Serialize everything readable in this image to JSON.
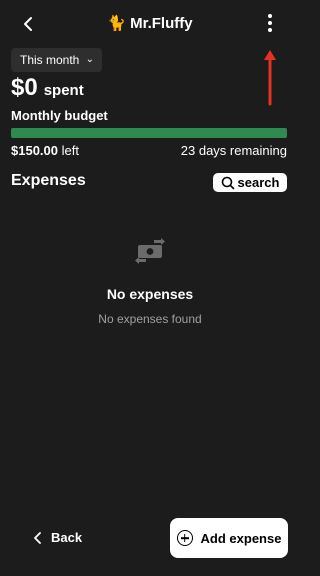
{
  "header": {
    "title": "Mr.Fluffy",
    "title_icon": "🐈",
    "back_icon": "chevron-left-icon",
    "more_icon": "more-vertical-icon"
  },
  "annotation": {
    "arrow_color": "#e53322"
  },
  "filter": {
    "period": "This month"
  },
  "summary": {
    "spent_amount": "$0",
    "spent_label": "spent",
    "budget_label": "Monthly budget",
    "left_amount": "$150.00",
    "left_suffix": "left",
    "days_remaining": "23 days remaining",
    "progress_remaining_fraction": 1.0,
    "progress_color": "#2f8a4f"
  },
  "expenses": {
    "title": "Expenses",
    "search_label": "search",
    "empty_title": "No expenses",
    "empty_subtitle": "No expenses found"
  },
  "footer": {
    "back_label": "Back",
    "add_label": "Add expense"
  }
}
